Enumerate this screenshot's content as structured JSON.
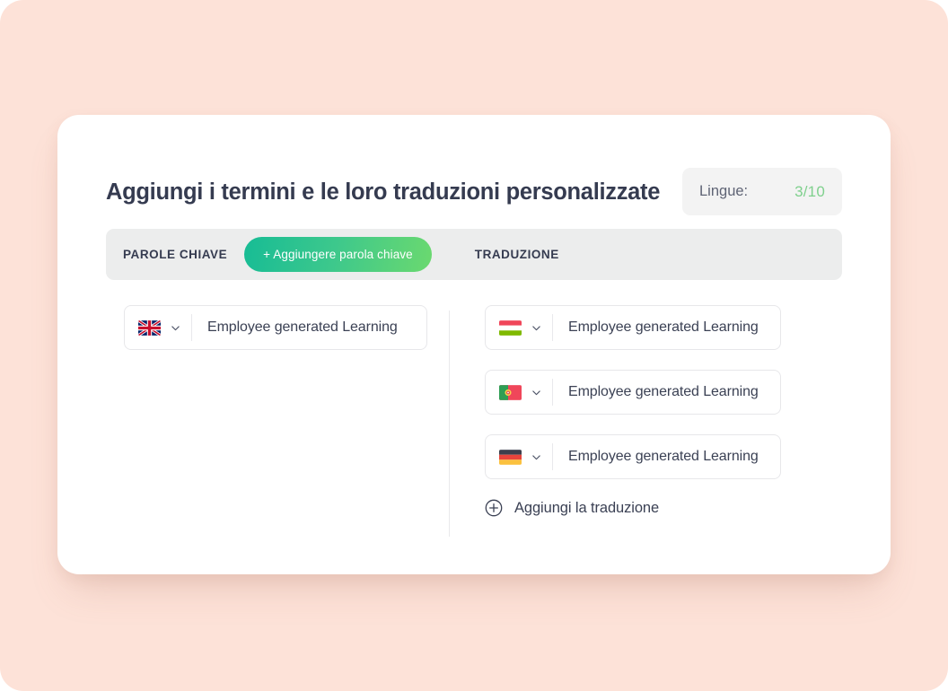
{
  "theme": {
    "page_background": "#fde2d8",
    "card_background": "#ffffff",
    "accent_green_start": "#17bc95",
    "accent_green_end": "#6bd96f",
    "count_green": "#7fd08d",
    "text_dark": "#353b50",
    "tabbar_background": "#eceded"
  },
  "header": {
    "title": "Aggiungi i termini e le loro traduzioni personalizzate",
    "languages": {
      "label": "Lingue:",
      "count": "3/10"
    }
  },
  "tabs": {
    "keywords_label": "PAROLE CHIAVE",
    "add_keyword_label": "+ Aggiungere parola chiave",
    "translation_label": "TRADUZIONE"
  },
  "keywords": [
    {
      "flag": "uk-flag-icon",
      "chevron": "chevron-down-icon",
      "value": "Employee generated Learning"
    }
  ],
  "translations": [
    {
      "flag": "hungary-flag-icon",
      "chevron": "chevron-down-icon",
      "value": "Employee generated Learning"
    },
    {
      "flag": "portugal-flag-icon",
      "chevron": "chevron-down-icon",
      "value": "Employee generated Learning"
    },
    {
      "flag": "germany-flag-icon",
      "chevron": "chevron-down-icon",
      "value": "Employee generated Learning"
    }
  ],
  "add_translation": {
    "icon": "plus-circle-icon",
    "label": "Aggiungi la traduzione"
  }
}
